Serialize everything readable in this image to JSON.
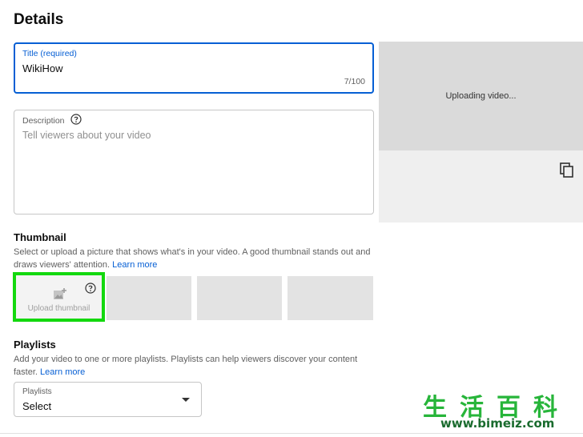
{
  "page": {
    "heading": "Details"
  },
  "title_field": {
    "label": "Title (required)",
    "value": "WikiHow",
    "counter": "7/100"
  },
  "description_field": {
    "label": "Description",
    "placeholder": "Tell viewers about your video",
    "help_icon": "help-circle-icon"
  },
  "preview": {
    "status": "Uploading video...",
    "copy_icon": "copy-icon"
  },
  "thumbnail": {
    "title": "Thumbnail",
    "description": "Select or upload a picture that shows what's in your video. A good thumbnail stands out and draws viewers' attention.",
    "learn_more": "Learn more",
    "upload_label": "Upload thumbnail",
    "upload_icon": "add-image-icon",
    "highlight_color": "#13d80e"
  },
  "playlists": {
    "title": "Playlists",
    "description": "Add your video to one or more playlists. Playlists can help viewers discover your content faster.",
    "learn_more": "Learn more",
    "select_label": "Playlists",
    "select_value": "Select"
  },
  "watermark": {
    "chinese": "生活百科",
    "url": "www.bimeiz.com"
  },
  "colors": {
    "accent": "#065fd4",
    "border": "#c6c6c6",
    "highlight": "#13d80e"
  }
}
